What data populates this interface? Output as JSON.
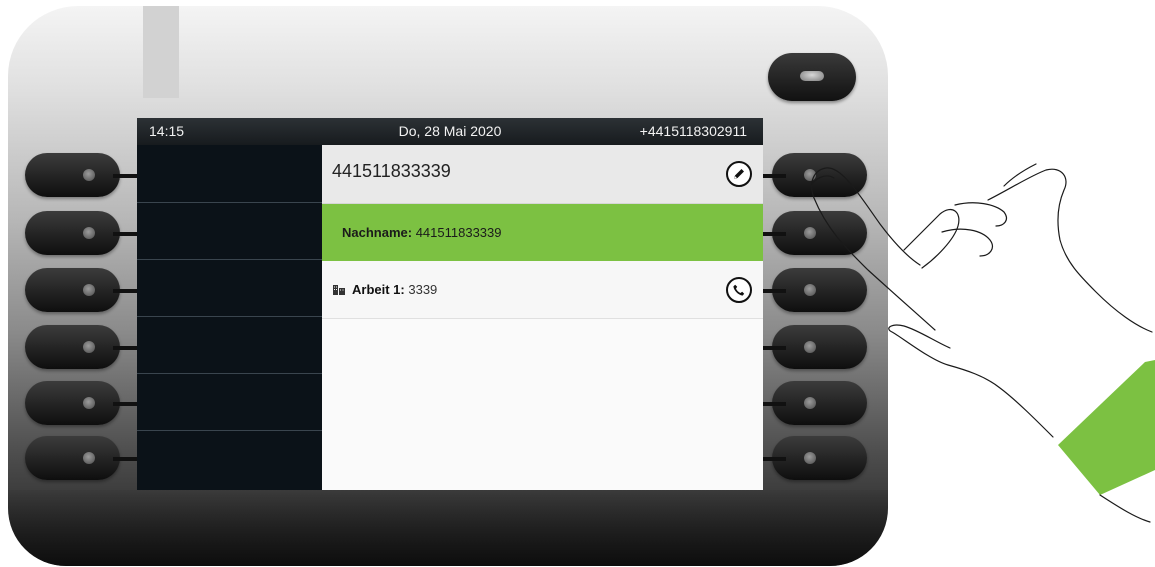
{
  "status_bar": {
    "time": "14:15",
    "date": "Do, 28 Mai 2020",
    "own_number": "+4415118302911"
  },
  "contact": {
    "number": "441511833339",
    "edit_icon": "pencil-icon",
    "fields": [
      {
        "label": "Nachname:",
        "value": "441511833339",
        "highlighted": true
      },
      {
        "label": "Arbeit 1:",
        "value": "3339",
        "icon": "office-building-icon",
        "action_icon": "phone-handset-icon"
      }
    ]
  },
  "colors": {
    "highlight": "#7cc142",
    "screen_background": "#0b1218",
    "wristband": "#7cc142"
  }
}
